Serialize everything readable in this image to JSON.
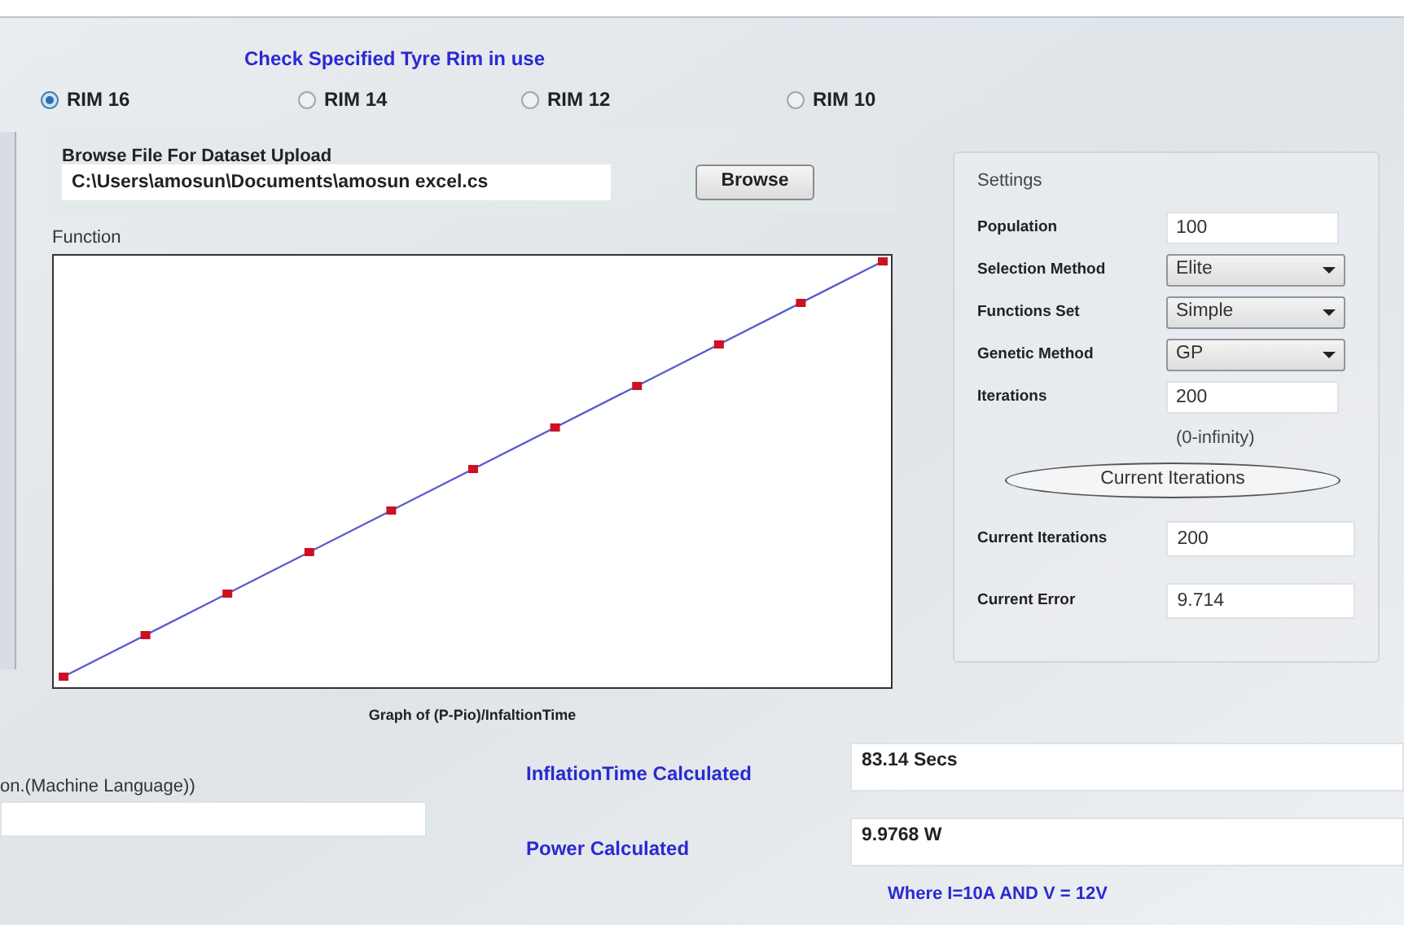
{
  "title": "Check Specified Tyre Rim in use",
  "rims": [
    {
      "label": "RIM 16",
      "selected": true
    },
    {
      "label": "RIM 14",
      "selected": false
    },
    {
      "label": "RIM 12",
      "selected": false
    },
    {
      "label": "RIM 10",
      "selected": false
    }
  ],
  "dataset": {
    "label": "Browse File For Dataset Upload",
    "path": "C:\\Users\\amosun\\Documents\\amosun excel.cs",
    "button": "Browse"
  },
  "function": {
    "label": "Function",
    "caption": "Graph of (P-Pio)/InfaltionTime"
  },
  "settings": {
    "title": "Settings",
    "rows": [
      {
        "kind": "input",
        "label": "Population",
        "value": "100"
      },
      {
        "kind": "dropdown",
        "label": "Selection Method",
        "value": "Elite"
      },
      {
        "kind": "dropdown",
        "label": "Functions Set",
        "value": "Simple"
      },
      {
        "kind": "dropdown",
        "label": "Genetic Method",
        "value": "GP"
      },
      {
        "kind": "input",
        "label": "Iterations",
        "value": "200"
      }
    ],
    "range_note": "(0-infinity)",
    "button": "Current Iterations",
    "results": [
      {
        "label": "Current Iterations",
        "value": "200"
      },
      {
        "label": "Current Error",
        "value": "9.714"
      }
    ]
  },
  "program": {
    "label": "on.(Machine Language))"
  },
  "outputs": [
    {
      "label": "InflationTime Calculated",
      "value": "83.14 Secs"
    },
    {
      "label": "Power Calculated",
      "value": "9.9768 W"
    }
  ],
  "output_note": "Where I=10A AND V = 12V"
}
